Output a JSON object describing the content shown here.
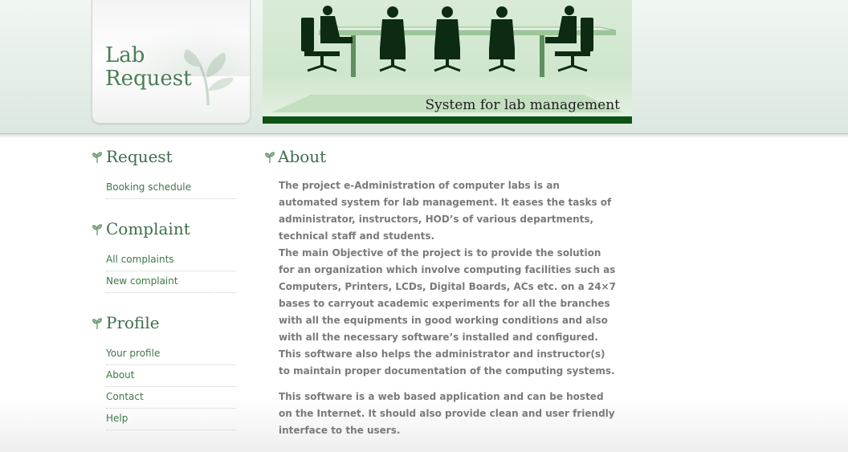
{
  "logo": {
    "line1": "Lab",
    "line2": "Request"
  },
  "banner": {
    "caption": "System for lab management"
  },
  "sidebar": {
    "sections": [
      {
        "heading": "Request",
        "links": [
          "Booking schedule"
        ]
      },
      {
        "heading": "Complaint",
        "links": [
          "All complaints",
          "New complaint"
        ]
      },
      {
        "heading": "Profile",
        "links": [
          "Your profile",
          "About",
          "Contact",
          "Help"
        ]
      }
    ]
  },
  "main": {
    "heading": "About",
    "paragraph1_line1": "The project e-Administration of computer labs is an automated system for lab management. It eases the tasks of administrator, instructors, HOD’s of various departments, technical   staff   and students.",
    "paragraph1_line2": "The main Objective  of the  project is to provide the solution for an organization which involve computing facilities such as Computers, Printers, LCDs, Digital Boards, ACs etc. on a 24×7 bases to carryout academic experiments for all the branches with all the equipments in good working conditions and also with all the necessary software’s installed and configured. This software  also helps the  administrator and instructor(s) to maintain proper documentation of the computing systems.",
    "paragraph2": "This software is a web based application and can be hosted on the Internet. It should also provide clean and user friendly interface to the users."
  },
  "colors": {
    "heading": "#3e6e4b",
    "link": "#3d7746",
    "body_text": "#7a7a7a",
    "banner_bar": "#0d5216",
    "banner_bg": "#cfe6cd"
  }
}
